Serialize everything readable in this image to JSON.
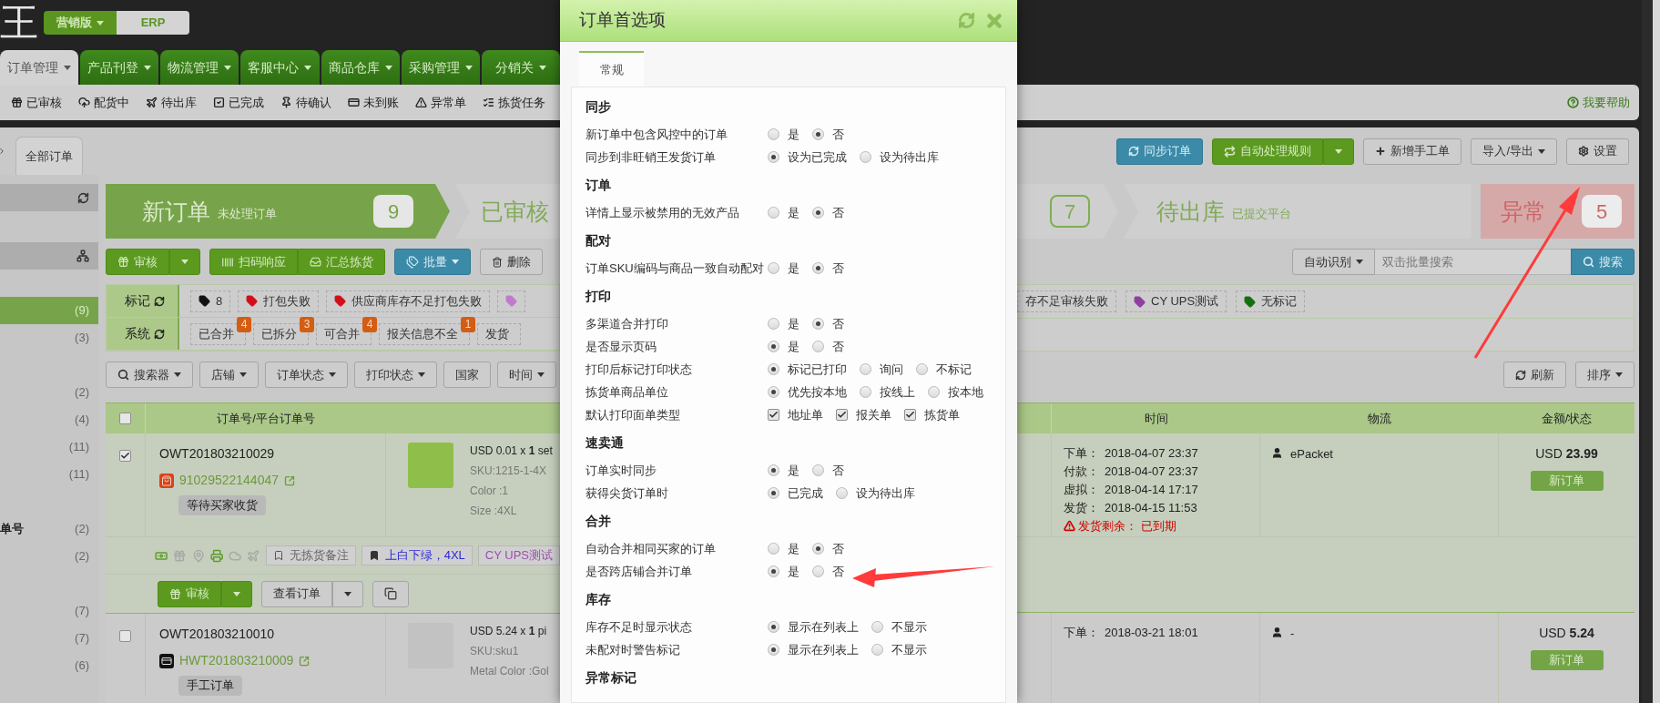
{
  "header": {
    "logo": "王",
    "editions": [
      {
        "label": "营销版",
        "selected": true
      },
      {
        "label": "ERP",
        "selected": false
      }
    ]
  },
  "main_nav": [
    {
      "label": "订单管理",
      "selected": true
    },
    {
      "label": "产品刊登",
      "selected": false
    },
    {
      "label": "物流管理",
      "selected": false
    },
    {
      "label": "客服中心",
      "selected": false
    },
    {
      "label": "商品仓库",
      "selected": false
    },
    {
      "label": "采购管理",
      "selected": false
    },
    {
      "label": "分销关",
      "selected": false
    }
  ],
  "sub_nav": {
    "items": [
      "已审核",
      "配货中",
      "待出库",
      "已完成",
      "待确认",
      "未到账",
      "异常单",
      "拣货任务"
    ],
    "help": "我要帮助"
  },
  "page_tabs": [
    {
      "label": "全部订单",
      "selected": true
    }
  ],
  "toolbar": {
    "sync": "同步订单",
    "rules": "自动处理规则",
    "new_manual": "新增手工单",
    "import_export": "导入/导出",
    "settings": "设置"
  },
  "sidebar": {
    "groups": [
      {
        "items": [
          {
            "count": "(9)",
            "selected": true
          },
          {
            "count": "(3)",
            "selected": false
          }
        ]
      },
      {
        "items": [
          {
            "count": "(2)",
            "selected": false
          },
          {
            "count": "(4)",
            "selected": false
          },
          {
            "count": "(11)",
            "selected": false
          },
          {
            "count": "(11)",
            "selected": false
          }
        ]
      },
      {
        "items": [
          {
            "label": "单号",
            "count": "(2)",
            "selected": false
          },
          {
            "count": "(2)",
            "selected": false
          }
        ]
      },
      {
        "items": [
          {
            "count": "(7)",
            "selected": false
          },
          {
            "count": "(7)",
            "selected": false
          },
          {
            "count": "(6)",
            "selected": false
          }
        ]
      }
    ]
  },
  "pipeline": [
    {
      "title": "新订单",
      "subtitle": "未处理订单",
      "count": "9",
      "kind": "active"
    },
    {
      "title": "已审核",
      "kind": "normal"
    },
    {
      "count": "7",
      "kind": "normal"
    },
    {
      "title": "待出库",
      "subtitle": "已提交平台",
      "kind": "normal"
    },
    {
      "title": "异常",
      "count": "5",
      "kind": "danger"
    }
  ],
  "actions": {
    "approve": "审核",
    "scan": "扫码响应",
    "summary": "汇总拣货",
    "batch": "批量",
    "delete": "删除",
    "search_mode": "自动识别",
    "search": {
      "placeholder": "双击批量搜索"
    },
    "search_button": "搜索"
  },
  "marks": {
    "label": "标记",
    "tags": [
      {
        "label": "8",
        "color": "#111111"
      },
      {
        "label": "打包失败",
        "color": "#d0101a"
      },
      {
        "label": "供应商库存不足打包失败",
        "color": "#d0101a"
      },
      {
        "color": "#c07ccc"
      },
      {
        "label": "存不足审核失败"
      },
      {
        "label": "CY UPS测试",
        "color": "#8e3fa0"
      },
      {
        "label": "无标记",
        "color": "#13700f"
      }
    ]
  },
  "system": {
    "label": "系统",
    "tags": [
      {
        "label": "已合并",
        "count": "4"
      },
      {
        "label": "已拆分",
        "count": "3"
      },
      {
        "label": "可合并",
        "count": "4"
      },
      {
        "label": "报关信息不全",
        "count": "1"
      },
      {
        "label": "发货"
      }
    ]
  },
  "filters": {
    "searcher": "搜索器",
    "shop": "店铺",
    "order_status": "订单状态",
    "print_status": "打印状态",
    "country": "国家",
    "time": "时间",
    "refresh": "刷新",
    "sort": "排序"
  },
  "table": {
    "header_checked": false,
    "columns": [
      "订单号/平台订单号",
      "时间",
      "物流",
      "金额/状态"
    ],
    "rows": [
      {
        "checked": true,
        "order_no": "OWT201803210029",
        "platform_no": "91029522144047",
        "status_tag": "等待买家收货",
        "product_lines": [
          "USD 0.01 x **1** set",
          "SKU:1215-1-4X",
          "Color :1",
          "Size :4XL"
        ],
        "times": [
          {
            "label": "下单：",
            "value": "2018-04-07 23:37"
          },
          {
            "label": "付款：",
            "value": "2018-04-07 23:37"
          },
          {
            "label": "虚拟：",
            "value": "2018-04-14 17:17"
          },
          {
            "label": "发货：",
            "value": "2018-04-15 11:53"
          }
        ],
        "warning": "发货剩余： 已到期",
        "logistics": "ePacket",
        "amount": "USD **23.99**",
        "status": "新订单",
        "status_icons": [
          {
            "on": true
          },
          {
            "on": false
          },
          {
            "on": false
          },
          {
            "on": true
          },
          {
            "on": false
          },
          {
            "on": false
          }
        ],
        "notes": [
          {
            "label": "无拣货备注",
            "kind": "outline"
          },
          {
            "label": "上白下绿，4XL",
            "kind": "filled"
          },
          {
            "label": "CY UPS测试",
            "kind": "tag"
          }
        ],
        "buttons": {
          "approve": "审核",
          "view": "查看订单"
        }
      },
      {
        "checked": false,
        "order_no": "OWT201803210010",
        "platform_no": "HWT201803210009",
        "status_tag": "手工订单",
        "product_lines": [
          "USD 5.24 x **1** pi",
          "SKU:sku1",
          "Metal Color :Gol"
        ],
        "times": [
          {
            "label": "下单：",
            "value": "2018-03-21 18:01"
          }
        ],
        "logistics": "-",
        "amount": "USD **5.24**",
        "status": "新订单"
      }
    ]
  },
  "modal": {
    "title": "订单首选项",
    "tabs": [
      {
        "label": "常规",
        "selected": true
      }
    ],
    "sections": [
      {
        "title": "同步",
        "settings": [
          {
            "label": "新订单中包含风控中的订单",
            "kind": "radio",
            "options": [
              {
                "label": "是",
                "selected": false
              },
              {
                "label": "否",
                "selected": true
              }
            ]
          },
          {
            "label": "同步到非旺销王发货订单",
            "kind": "radio",
            "options": [
              {
                "label": "设为已完成",
                "selected": true
              },
              {
                "label": "设为待出库",
                "selected": false
              }
            ]
          }
        ]
      },
      {
        "title": "订单",
        "settings": [
          {
            "label": "详情上显示被禁用的无效产品",
            "kind": "radio",
            "options": [
              {
                "label": "是",
                "selected": false
              },
              {
                "label": "否",
                "selected": true
              }
            ]
          }
        ]
      },
      {
        "title": "配对",
        "settings": [
          {
            "label": "订单SKU编码与商品一致自动配对",
            "kind": "radio",
            "options": [
              {
                "label": "是",
                "selected": false
              },
              {
                "label": "否",
                "selected": true
              }
            ]
          }
        ]
      },
      {
        "title": "打印",
        "settings": [
          {
            "label": "多渠道合并打印",
            "kind": "radio",
            "options": [
              {
                "label": "是",
                "selected": false
              },
              {
                "label": "否",
                "selected": true
              }
            ]
          },
          {
            "label": "是否显示页码",
            "kind": "radio",
            "options": [
              {
                "label": "是",
                "selected": true
              },
              {
                "label": "否",
                "selected": false
              }
            ]
          },
          {
            "label": "打印后标记打印状态",
            "kind": "radio",
            "options": [
              {
                "label": "标记已打印",
                "selected": true
              },
              {
                "label": "询问",
                "selected": false
              },
              {
                "label": "不标记",
                "selected": false
              }
            ]
          },
          {
            "label": "拣货单商品单位",
            "kind": "radio",
            "options": [
              {
                "label": "优先按本地",
                "selected": true
              },
              {
                "label": "按线上",
                "selected": false
              },
              {
                "label": "按本地",
                "selected": false
              }
            ]
          },
          {
            "label": "默认打印面单类型",
            "kind": "checkbox",
            "options": [
              {
                "label": "地址单",
                "checked": true
              },
              {
                "label": "报关单",
                "checked": true
              },
              {
                "label": "拣货单",
                "checked": true
              }
            ]
          }
        ]
      },
      {
        "title": "速卖通",
        "settings": [
          {
            "label": "订单实时同步",
            "kind": "radio",
            "options": [
              {
                "label": "是",
                "selected": true
              },
              {
                "label": "否",
                "selected": false
              }
            ]
          },
          {
            "label": "获得尖货订单时",
            "kind": "radio",
            "options": [
              {
                "label": "已完成",
                "selected": true
              },
              {
                "label": "设为待出库",
                "selected": false
              }
            ]
          }
        ]
      },
      {
        "title": "合并",
        "settings": [
          {
            "label": "自动合并相同买家的订单",
            "kind": "radio",
            "options": [
              {
                "label": "是",
                "selected": false
              },
              {
                "label": "否",
                "selected": true
              }
            ]
          },
          {
            "label": "是否跨店铺合并订单",
            "kind": "radio",
            "options": [
              {
                "label": "是",
                "selected": true
              },
              {
                "label": "否",
                "selected": false
              }
            ]
          }
        ]
      },
      {
        "title": "库存",
        "settings": [
          {
            "label": "库存不足时显示状态",
            "kind": "radio",
            "options": [
              {
                "label": "显示在列表上",
                "selected": true
              },
              {
                "label": "不显示",
                "selected": false
              }
            ]
          },
          {
            "label": "未配对时警告标记",
            "kind": "radio",
            "options": [
              {
                "label": "显示在列表上",
                "selected": true
              },
              {
                "label": "不显示",
                "selected": false
              }
            ]
          }
        ]
      },
      {
        "title": "异常标记"
      }
    ]
  }
}
